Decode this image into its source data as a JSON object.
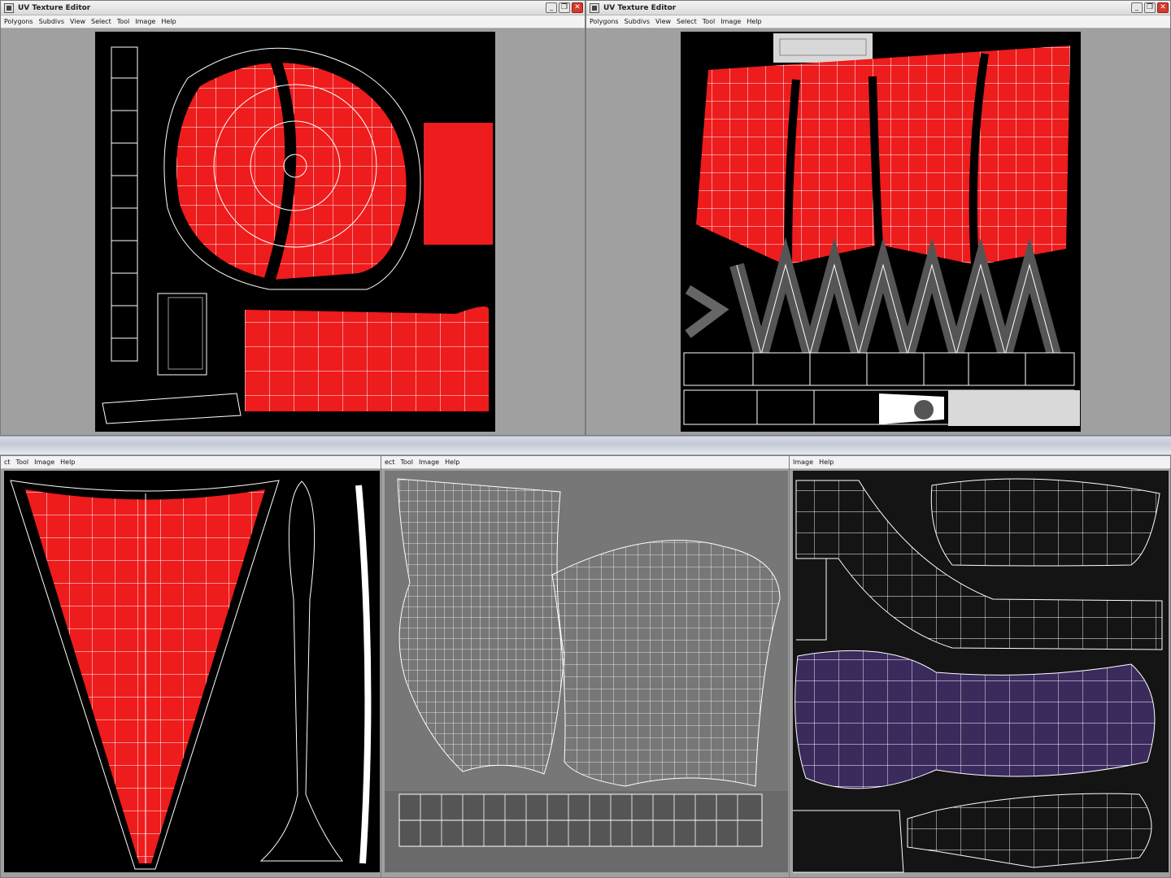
{
  "windows": {
    "left": {
      "title": "UV Texture Editor",
      "menu": [
        "Polygons",
        "Subdivs",
        "View",
        "Select",
        "Tool",
        "Image",
        "Help"
      ]
    },
    "right": {
      "title": "UV Texture Editor",
      "menu": [
        "Polygons",
        "Subdivs",
        "View",
        "Select",
        "Tool",
        "Image",
        "Help"
      ]
    },
    "bottom_left": {
      "menu": [
        "ct",
        "Tool",
        "Image",
        "Help"
      ]
    },
    "bottom_middle": {
      "menu": [
        "ect",
        "Tool",
        "Image",
        "Help"
      ]
    },
    "bottom_right": {
      "menu": [
        "Image",
        "Help"
      ]
    }
  },
  "window_buttons": {
    "minimize": "_",
    "restore": "❐",
    "close": "✕"
  },
  "colors": {
    "uv_background": "#000000",
    "editor_background": "#a0a0a0",
    "shell_fill_red": "#ee1c1c",
    "shell_fill_purple": "#3b2a5c",
    "wireframe": "#ffffff"
  }
}
